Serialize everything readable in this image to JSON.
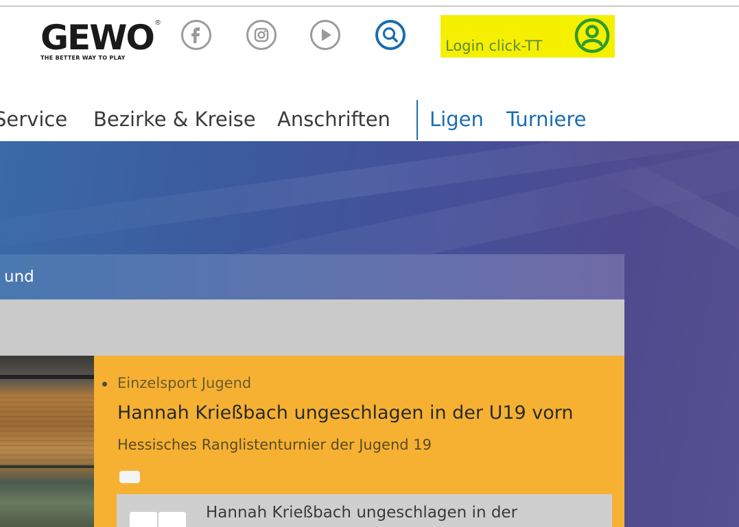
{
  "logo": {
    "brand": "GEWO",
    "registered": "®",
    "tagline": "THE BETTER WAY TO PLAY"
  },
  "social": {
    "icons": [
      "facebook-icon",
      "instagram-icon",
      "play-icon"
    ],
    "search_icon": "search-icon"
  },
  "login": {
    "label": "Login click-TT",
    "icon": "user-circle-icon",
    "highlight": "#f5ef00"
  },
  "nav": {
    "items": [
      "Service",
      "Bezirke & Kreise",
      "Anschriften"
    ],
    "secondary": [
      "Ligen",
      "Turniere"
    ]
  },
  "panel": {
    "heading": "und"
  },
  "news": {
    "category": "Einzelsport Jugend",
    "title": "Hannah Krießbach ungeschlagen in der U19 vorn",
    "subtitle": "Hessisches Ranglistenturnier der Jugend 19",
    "card_text": "Hannah Krießbach ungeschlagen in der"
  },
  "colors": {
    "accent_blue": "#1a6db0",
    "news_bg": "#f6b132",
    "login_text": "#5c8a3c"
  }
}
